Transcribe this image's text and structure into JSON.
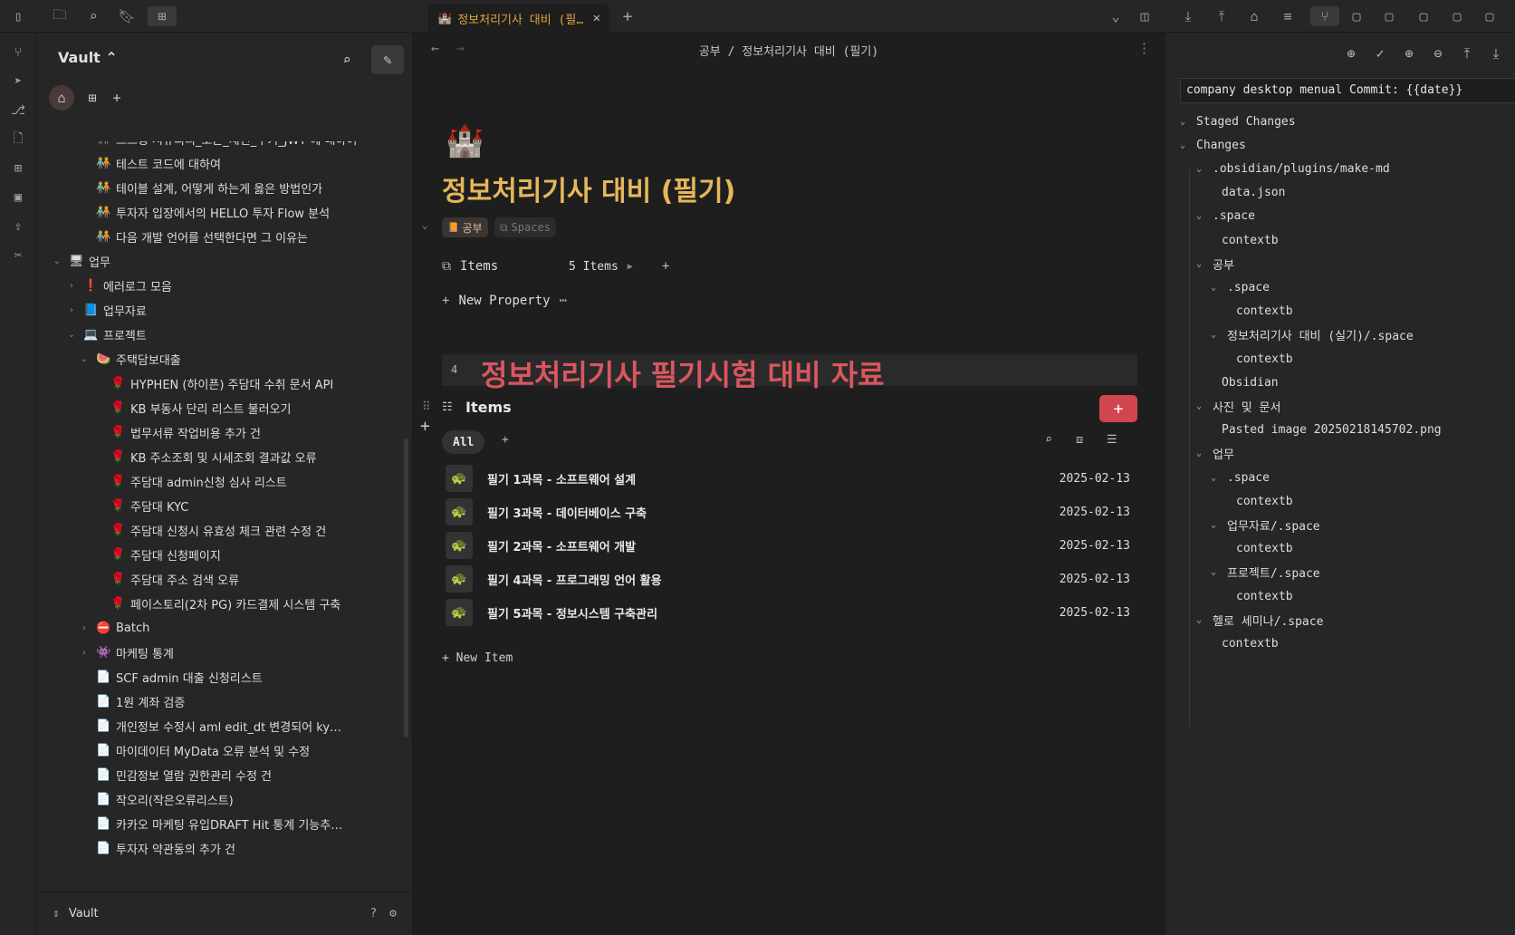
{
  "tab": {
    "title": "정보처리기사 대비 (필기)",
    "icon": "🏰",
    "close": "✕",
    "new": "+"
  },
  "topbar_icons": [
    "sidebar-toggle-icon",
    "folder-icon",
    "search-icon",
    "bookmark-icon",
    "grid-icon",
    "chevron-down-icon",
    "split-view-icon",
    "git-pull-icon",
    "git-push-icon",
    "tag-icon",
    "list-icon",
    "git-branch-icon",
    "file-icon",
    "file-icon",
    "file-icon",
    "file-icon",
    "file-icon"
  ],
  "ribbon_icons": [
    "branch-icon",
    "send-icon",
    "git-icon",
    "file-search-icon",
    "grid-icon",
    "image-icon",
    "upload-icon",
    "tools-icon"
  ],
  "sidebar": {
    "vault_label": "Vault ⌃",
    "footer_label": "Vault",
    "tree": [
      {
        "label": "스프링 시큐리티_토큰_세션_쿠키_JWT 에 대하여",
        "icon": "🧑‍🤝‍🧑",
        "indent": 2,
        "chev": ""
      },
      {
        "label": "테스트 코드에 대하여",
        "icon": "🧑‍🤝‍🧑",
        "indent": 2,
        "chev": ""
      },
      {
        "label": "테이블 설계, 어떻게 하는게 옳은 방법인가",
        "icon": "🧑‍🤝‍🧑",
        "indent": 2,
        "chev": ""
      },
      {
        "label": "투자자 입장에서의 HELLO 투자 Flow 분석",
        "icon": "🧑‍🤝‍🧑",
        "indent": 2,
        "chev": ""
      },
      {
        "label": "다음 개발 언어를 선택한다면 그 이유는",
        "icon": "🧑‍🤝‍🧑",
        "indent": 2,
        "chev": ""
      },
      {
        "label": "업무",
        "icon": "🖥",
        "indent": 0,
        "chev": "⌄"
      },
      {
        "label": "에러로그 모음",
        "icon": "❗",
        "indent": 1,
        "chev": "›"
      },
      {
        "label": "업무자료",
        "icon": "📘",
        "indent": 1,
        "chev": "›"
      },
      {
        "label": "프로젝트",
        "icon": "💻",
        "indent": 1,
        "chev": "⌄"
      },
      {
        "label": "주택담보대출",
        "icon": "🍉",
        "indent": 2,
        "chev": "⌄"
      },
      {
        "label": "HYPHEN (하이픈) 주담대 수취 문서 API",
        "icon": "🌹",
        "indent": 3,
        "chev": ""
      },
      {
        "label": "KB 부동사 단리 리스트 불러오기",
        "icon": "🌹",
        "indent": 3,
        "chev": ""
      },
      {
        "label": "법무서류 작업비용 추가 건",
        "icon": "🌹",
        "indent": 3,
        "chev": ""
      },
      {
        "label": "KB 주소조회 및 시세조회 결과값 오류",
        "icon": "🌹",
        "indent": 3,
        "chev": ""
      },
      {
        "label": "주담대 admin신청 심사 리스트",
        "icon": "🌹",
        "indent": 3,
        "chev": ""
      },
      {
        "label": "주담대 KYC",
        "icon": "🌹",
        "indent": 3,
        "chev": ""
      },
      {
        "label": "주담대 신청시 유효성 체크 관련 수정 건",
        "icon": "🌹",
        "indent": 3,
        "chev": ""
      },
      {
        "label": "주담대 신청페이지",
        "icon": "🌹",
        "indent": 3,
        "chev": ""
      },
      {
        "label": "주담대 주소 검색 오류",
        "icon": "🌹",
        "indent": 3,
        "chev": ""
      },
      {
        "label": "페이스토리(2차 PG) 카드결제 시스템 구축",
        "icon": "🌹",
        "indent": 3,
        "chev": ""
      },
      {
        "label": "Batch",
        "icon": "⛔",
        "indent": 2,
        "chev": "›"
      },
      {
        "label": "마케팅 통계",
        "icon": "👾",
        "indent": 2,
        "chev": "›"
      },
      {
        "label": "SCF admin 대출 신청리스트",
        "icon": "📄",
        "indent": 2,
        "chev": ""
      },
      {
        "label": "1원 계좌 검증",
        "icon": "📄",
        "indent": 2,
        "chev": ""
      },
      {
        "label": "개인정보 수정시 aml edit_dt 변경되어 ky…",
        "icon": "📄",
        "indent": 2,
        "chev": ""
      },
      {
        "label": "마이데이터 MyData 오류 분석 및 수정",
        "icon": "📄",
        "indent": 2,
        "chev": ""
      },
      {
        "label": "민감정보 열람 권한관리 수정 건",
        "icon": "📄",
        "indent": 2,
        "chev": ""
      },
      {
        "label": "작오리(작은오류리스트)",
        "icon": "📄",
        "indent": 2,
        "chev": ""
      },
      {
        "label": "카카오 마케팅 유입DRAFT Hit 통계 기능추…",
        "icon": "📄",
        "indent": 2,
        "chev": ""
      },
      {
        "label": "투자자 약관동의 추가 건",
        "icon": "📄",
        "indent": 2,
        "chev": ""
      }
    ]
  },
  "main": {
    "breadcrumb": "공부 / 정보처리기사 대비 (필기)",
    "title_icon": "🏰",
    "title": "정보처리기사 대비 (필기)",
    "tags": [
      {
        "label": "공부",
        "icon": "📙"
      },
      {
        "label": "Spaces",
        "icon": "⧉"
      }
    ],
    "property_items_label": "Items",
    "property_items_value": "5 Items",
    "new_property": "New Property",
    "heading_line": "4",
    "heading": "정보처리기사 필기시험 대비 자료",
    "items_title": "Items",
    "filter_all": "All",
    "items": [
      {
        "name": "필기 1과목 - 소프트웨어 설계",
        "date": "2025-02-13",
        "icon": "🐢"
      },
      {
        "name": "필기 3과목 - 데이터베이스 구축",
        "date": "2025-02-13",
        "icon": "🐢"
      },
      {
        "name": "필기 2과목 - 소프트웨어 개발",
        "date": "2025-02-13",
        "icon": "🐢"
      },
      {
        "name": "필기 4과목 - 프로그래밍 언어 활용",
        "date": "2025-02-13",
        "icon": "🐢"
      },
      {
        "name": "필기 5과목 - 정보시스템 구축관리",
        "date": "2025-02-13",
        "icon": "🐢"
      }
    ],
    "new_item": "+ New Item"
  },
  "git": {
    "commit_message": "company desktop menual Commit: {{date}}",
    "rows": [
      {
        "label": "Staged Changes",
        "level": 0,
        "chev": "⌄"
      },
      {
        "label": "Changes",
        "level": 0,
        "chev": "⌄"
      },
      {
        "label": ".obsidian/plugins/make-md",
        "level": 1,
        "chev": "⌄"
      },
      {
        "label": "data.json",
        "level": 2,
        "chev": ""
      },
      {
        "label": ".space",
        "level": 1,
        "chev": "⌄"
      },
      {
        "label": "contextb",
        "level": 2,
        "chev": ""
      },
      {
        "label": "공부",
        "level": 1,
        "chev": "⌄"
      },
      {
        "label": ".space",
        "level": 2,
        "chev": "⌄"
      },
      {
        "label": "contextb",
        "level": 3,
        "chev": ""
      },
      {
        "label": "정보처리기사 대비 (실기)/.space",
        "level": 2,
        "chev": "⌄"
      },
      {
        "label": "contextb",
        "level": 3,
        "chev": ""
      },
      {
        "label": "Obsidian",
        "level": 2,
        "chev": ""
      },
      {
        "label": "사진 및 문서",
        "level": 1,
        "chev": "⌄"
      },
      {
        "label": "Pasted image 20250218145702.png",
        "level": 2,
        "chev": ""
      },
      {
        "label": "업무",
        "level": 1,
        "chev": "⌄"
      },
      {
        "label": ".space",
        "level": 2,
        "chev": "⌄"
      },
      {
        "label": "contextb",
        "level": 3,
        "chev": ""
      },
      {
        "label": "업무자료/.space",
        "level": 2,
        "chev": "⌄"
      },
      {
        "label": "contextb",
        "level": 3,
        "chev": ""
      },
      {
        "label": "프로젝트/.space",
        "level": 2,
        "chev": "⌄"
      },
      {
        "label": "contextb",
        "level": 3,
        "chev": ""
      },
      {
        "label": "헬로 세미나/.space",
        "level": 1,
        "chev": "⌄"
      },
      {
        "label": "contextb",
        "level": 2,
        "chev": ""
      }
    ]
  },
  "colors": {
    "accent": "#d0454e",
    "title": "#e5b75a",
    "heading": "#d9575f",
    "tab": "#e0a43a"
  }
}
